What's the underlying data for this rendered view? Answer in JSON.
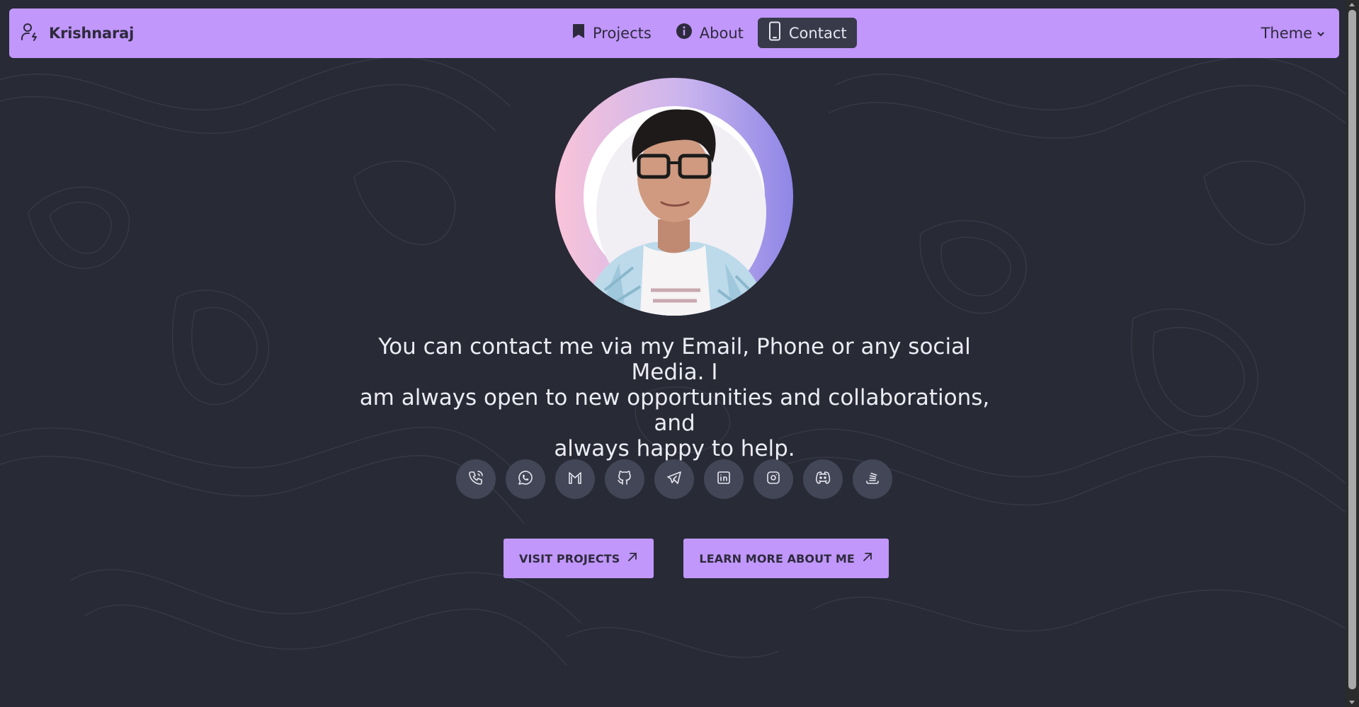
{
  "colors": {
    "accent": "#c197fb",
    "background": "#282a36",
    "nav_active_bg": "#383a4a",
    "social_bg": "#434656"
  },
  "navbar": {
    "brand": {
      "name": "Krishnaraj",
      "icon": "user-bolt-icon"
    },
    "links": [
      {
        "label": "Projects",
        "icon": "bookmark-icon",
        "active": false
      },
      {
        "label": "About",
        "icon": "info-icon",
        "active": false
      },
      {
        "label": "Contact",
        "icon": "smartphone-icon",
        "active": true
      }
    ],
    "theme_label": "Theme"
  },
  "hero": {
    "avatar": "profile-photo",
    "bio_line1": "You can contact me via my Email, Phone or any social Media. I",
    "bio_line2": "am always open to new opportunities and collaborations, and",
    "bio_line3": "always happy to help."
  },
  "socials": [
    {
      "name": "phone",
      "icon": "phone-call-icon"
    },
    {
      "name": "whatsapp",
      "icon": "whatsapp-icon"
    },
    {
      "name": "gmail",
      "icon": "gmail-icon"
    },
    {
      "name": "github",
      "icon": "github-icon"
    },
    {
      "name": "telegram",
      "icon": "telegram-icon"
    },
    {
      "name": "linkedin",
      "icon": "linkedin-icon"
    },
    {
      "name": "instagram",
      "icon": "instagram-icon"
    },
    {
      "name": "discord",
      "icon": "discord-icon"
    },
    {
      "name": "stackoverflow",
      "icon": "stackoverflow-icon"
    }
  ],
  "actions": {
    "visit_projects": "VISIT PROJECTS",
    "learn_more": "LEARN MORE ABOUT ME"
  }
}
